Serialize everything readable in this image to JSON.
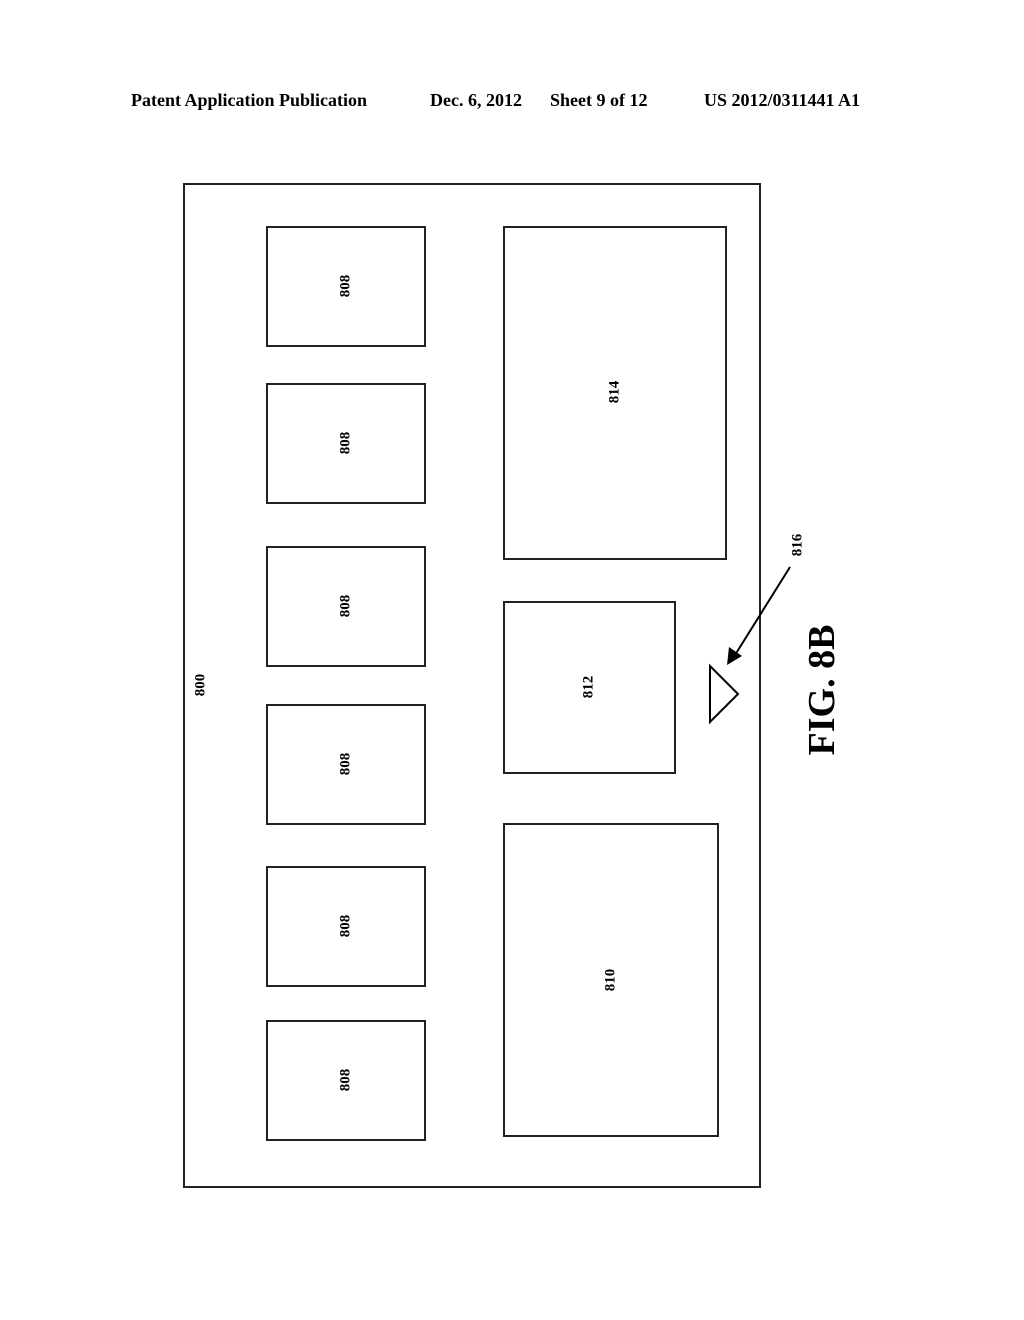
{
  "header": {
    "publication": "Patent Application Publication",
    "date": "Dec. 6, 2012",
    "sheet": "Sheet 9 of 12",
    "number": "US 2012/0311441 A1"
  },
  "figure": {
    "caption": "FIG. 8B",
    "outer_label": "800",
    "tiles": [
      "808",
      "808",
      "808",
      "808",
      "808",
      "808"
    ],
    "panel_top": "814",
    "panel_middle": "812",
    "panel_bottom": "810",
    "pointer_label": "816"
  }
}
